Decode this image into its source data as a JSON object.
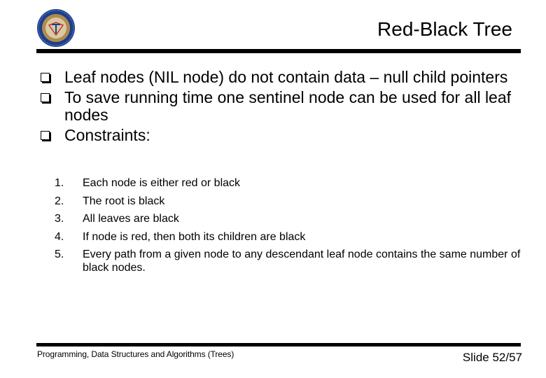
{
  "slide": {
    "logo": {
      "icon": "university-seal-icon",
      "colors": {
        "outer": "#1a3f8f",
        "ring": "#b08a4e",
        "inner": "#d9c9a3",
        "accent": "#c0392b"
      }
    },
    "title": "Red-Black Tree",
    "bullets": [
      {
        "icon": "checkbox-bullet-icon",
        "text": "Leaf nodes (NIL node) do not contain data – null child pointers"
      },
      {
        "icon": "checkbox-bullet-icon",
        "text": "To save running time one sentinel node can be used for all leaf nodes"
      },
      {
        "icon": "checkbox-bullet-icon",
        "text": "Constraints:"
      }
    ],
    "constraints": [
      {
        "num": "1.",
        "text": "Each node is either red or black"
      },
      {
        "num": "2.",
        "text": "The root is black"
      },
      {
        "num": "3.",
        "text": "All leaves are black"
      },
      {
        "num": "4.",
        "text": "If node is red, then both its children are black"
      },
      {
        "num": "5.",
        "text": "Every path from a given node to any descendant leaf node contains the same number of black nodes."
      }
    ],
    "footer": {
      "course": "Programming, Data Structures and Algorithms  (Trees)",
      "slide_number": "Slide 52/57"
    }
  }
}
